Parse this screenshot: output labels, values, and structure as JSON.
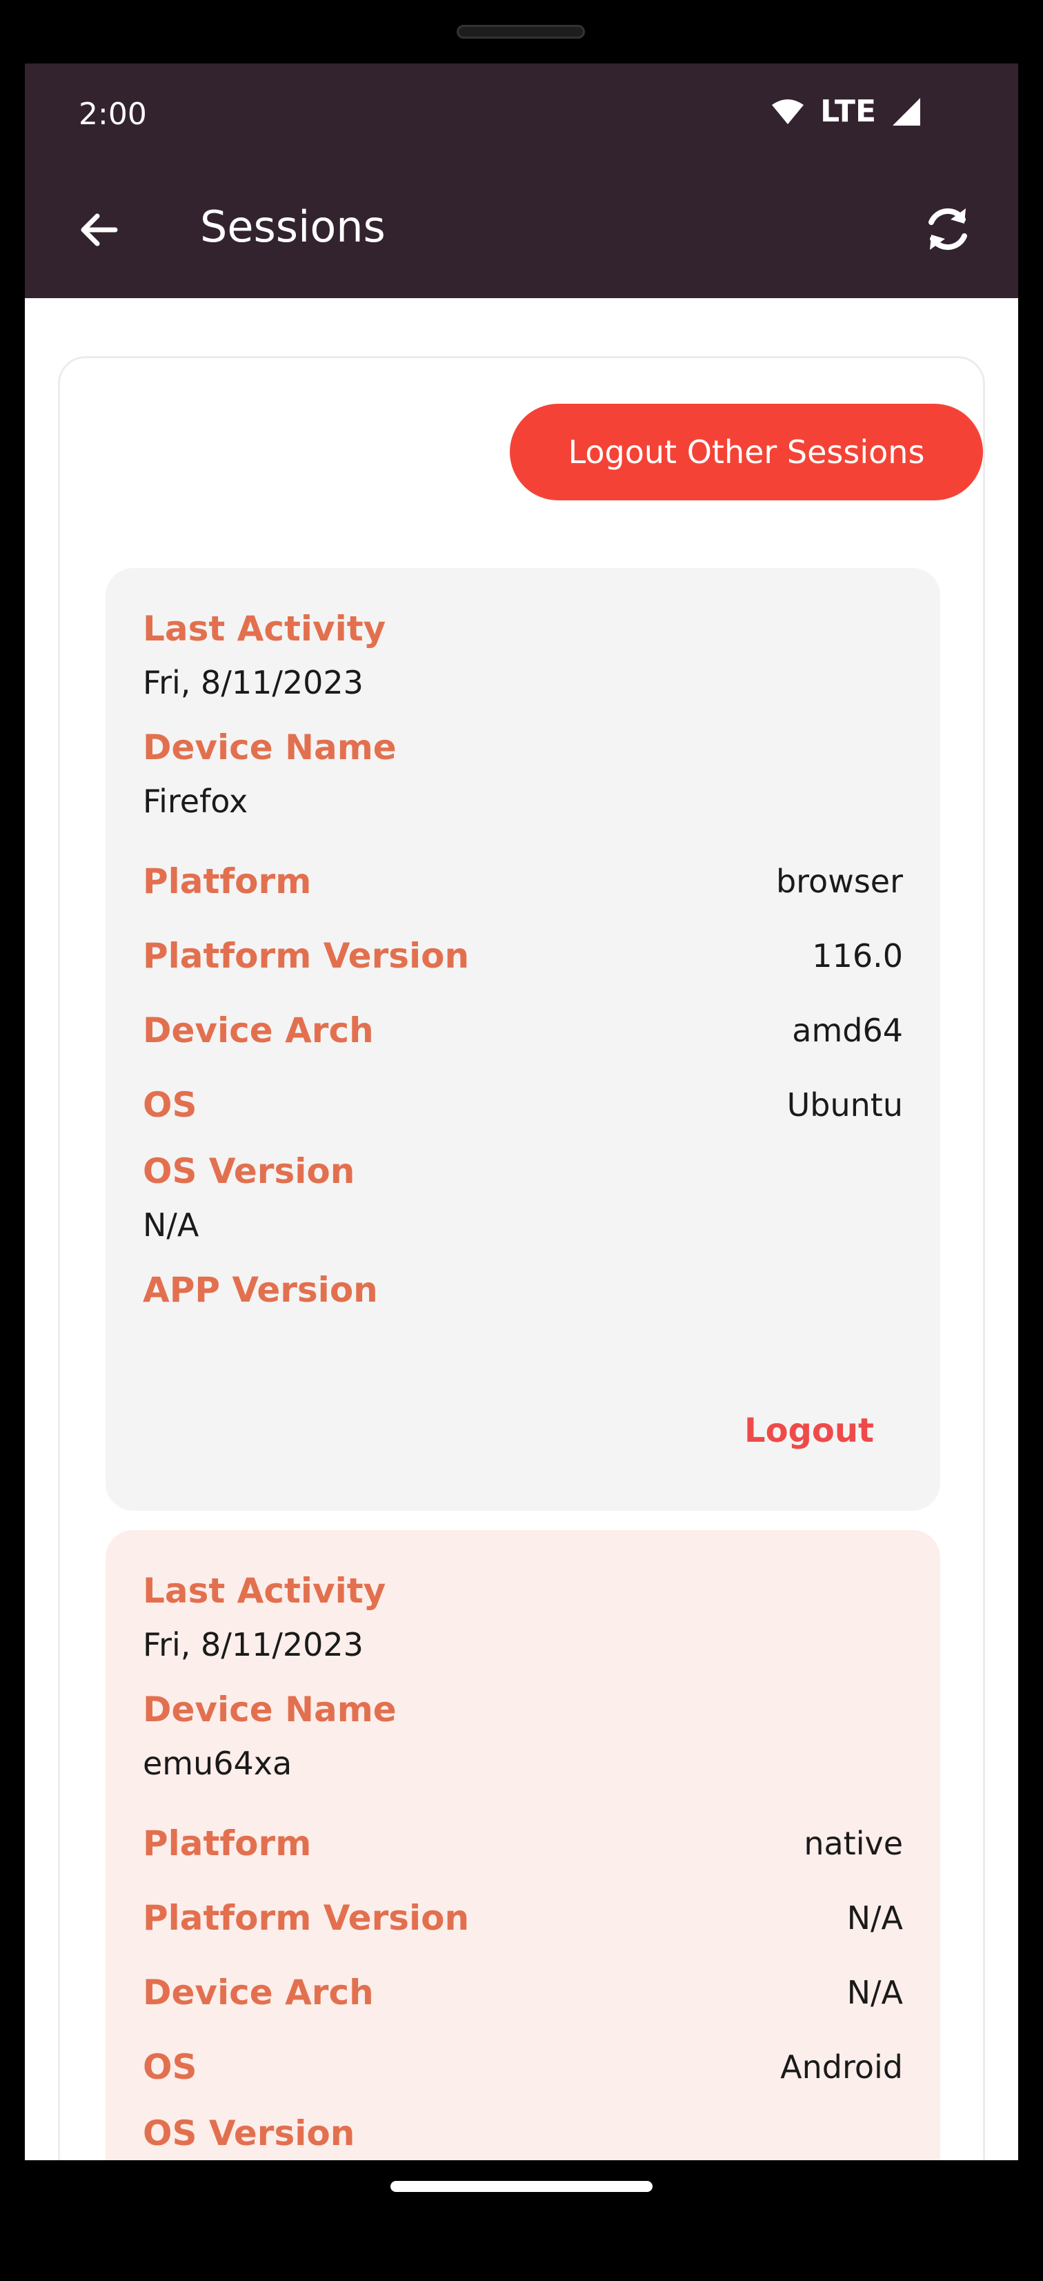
{
  "status_bar": {
    "time": "2:00",
    "network": "LTE"
  },
  "appbar": {
    "title": "Sessions",
    "back_icon": "arrow-left-icon",
    "refresh_icon": "sync-icon"
  },
  "actions": {
    "logout_others_label": "Logout Other Sessions"
  },
  "colors": {
    "appbar": "#33232f",
    "accent": "#f44336",
    "label": "#e2704f",
    "logout": "#ef4a4a",
    "card_gray": "#f4f4f4",
    "card_pink": "#fceeeb"
  },
  "sessions": [
    {
      "last_activity_label": "Last Activity",
      "last_activity": "Fri, 8/11/2023",
      "device_name_label": "Device Name",
      "device_name": "Firefox",
      "platform_label": "Platform",
      "platform": "browser",
      "platform_version_label": "Platform Version",
      "platform_version": "116.0",
      "device_arch_label": "Device Arch",
      "device_arch": "amd64",
      "os_label": "OS",
      "os": "Ubuntu",
      "os_version_label": "OS Version",
      "os_version": "N/A",
      "app_version_label": "APP Version",
      "app_version": "",
      "logout_label": "Logout"
    },
    {
      "last_activity_label": "Last Activity",
      "last_activity": "Fri, 8/11/2023",
      "device_name_label": "Device Name",
      "device_name": "emu64xa",
      "platform_label": "Platform",
      "platform": "native",
      "platform_version_label": "Platform Version",
      "platform_version": "N/A",
      "device_arch_label": "Device Arch",
      "device_arch": "N/A",
      "os_label": "OS",
      "os": "Android",
      "os_version_label": "OS Version"
    }
  ]
}
